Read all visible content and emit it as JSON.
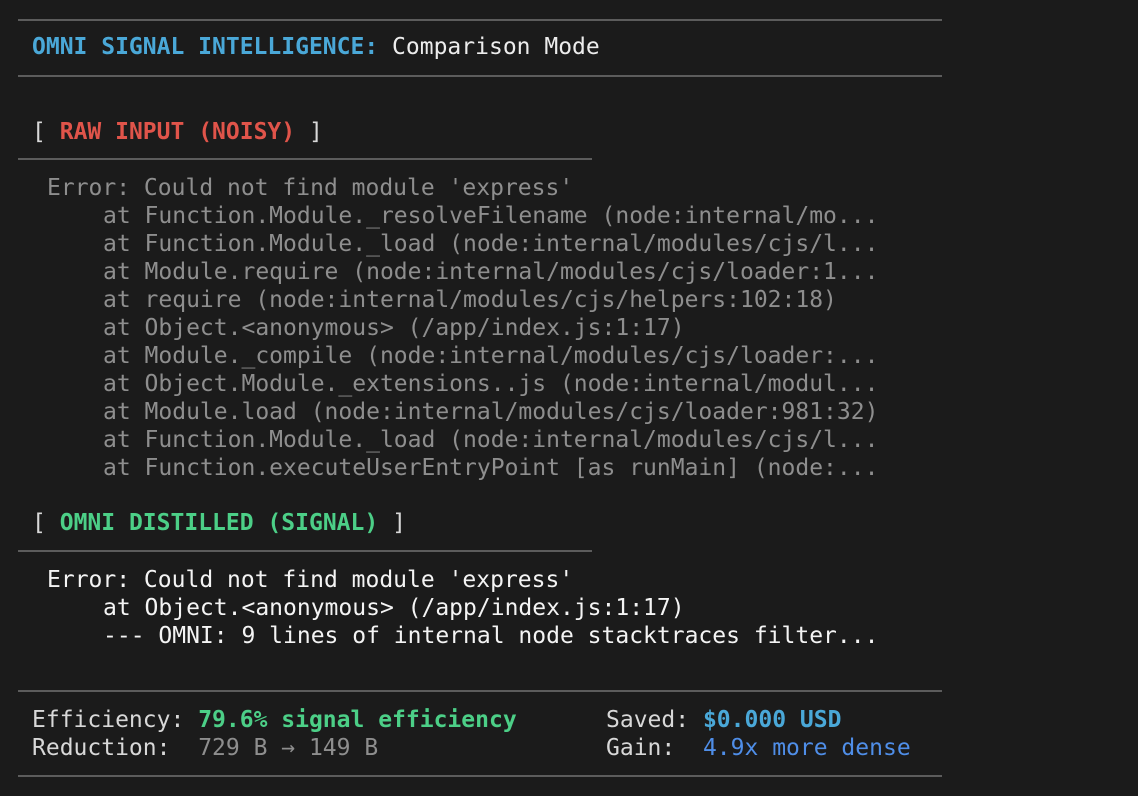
{
  "header": {
    "title_key": "OMNI SIGNAL INTELLIGENCE:",
    "title_value": "Comparison Mode"
  },
  "raw_section": {
    "bracket_open": "[",
    "label": "RAW INPUT (NOISY)",
    "bracket_close": "]",
    "lines": [
      "Error: Could not find module 'express'",
      "at Function.Module._resolveFilename (node:internal/mo...",
      "at Function.Module._load (node:internal/modules/cjs/l...",
      "at Module.require (node:internal/modules/cjs/loader:1...",
      "at require (node:internal/modules/cjs/helpers:102:18)",
      "at Object.<anonymous> (/app/index.js:1:17)",
      "at Module._compile (node:internal/modules/cjs/loader:...",
      "at Object.Module._extensions..js (node:internal/modul...",
      "at Module.load (node:internal/modules/cjs/loader:981:32)",
      "at Function.Module._load (node:internal/modules/cjs/l...",
      "at Function.executeUserEntryPoint [as runMain] (node:..."
    ]
  },
  "distilled_section": {
    "bracket_open": "[",
    "label": "OMNI DISTILLED (SIGNAL)",
    "bracket_close": "]",
    "lines": [
      "Error: Could not find module 'express'",
      "at Object.<anonymous> (/app/index.js:1:17)",
      "--- OMNI: 9 lines of internal node stacktraces filter..."
    ]
  },
  "stats": {
    "efficiency_label": "Efficiency:",
    "efficiency_value": "79.6% signal efficiency",
    "reduction_label": "Reduction:",
    "reduction_value": "729 B → 149 B",
    "saved_label": "Saved:",
    "saved_value": "$0.000 USD",
    "gain_label": "Gain:",
    "gain_value": "4.9x more dense"
  },
  "colors": {
    "background": "#1b1b1b",
    "title_accent": "#4aa8d8",
    "raw_accent": "#e0544a",
    "signal_accent": "#4ccf87",
    "gain_accent": "#4f8ee8"
  }
}
